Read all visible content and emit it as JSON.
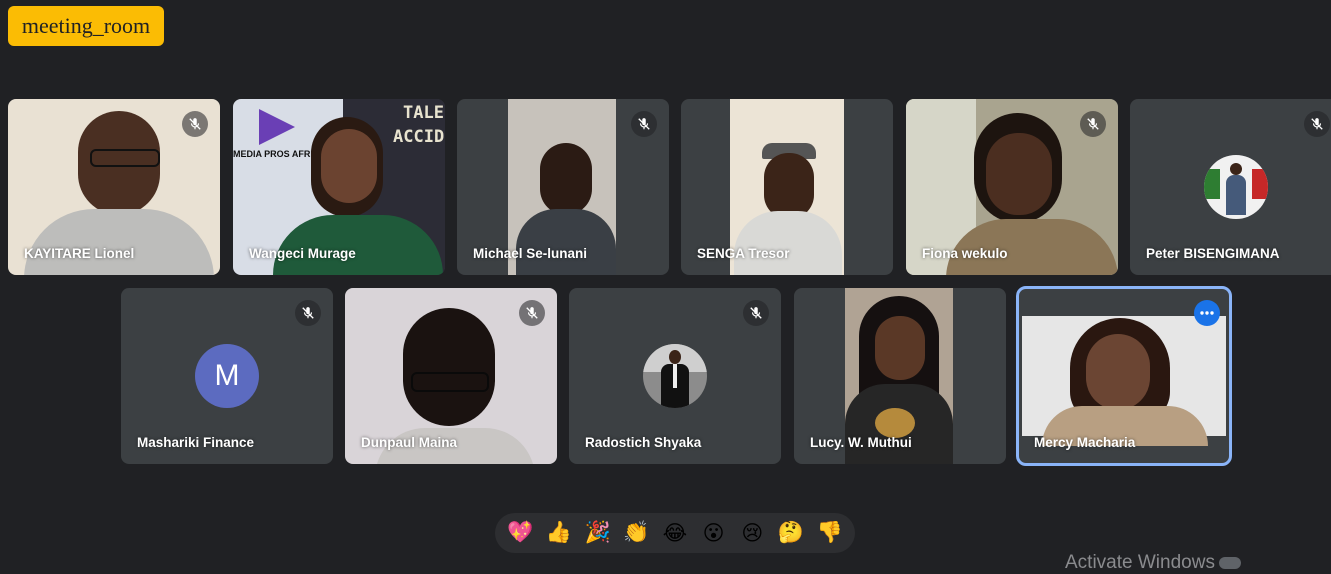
{
  "room": {
    "name": "meeting_room"
  },
  "participants": [
    {
      "name": "KAYITARE Lionel",
      "muted": true
    },
    {
      "name": "Wangeci Murage",
      "muted": false,
      "poster_text_1": "MEDIA PROS AFRIC",
      "poster_text_2": "TALE",
      "poster_text_3": "ACCID"
    },
    {
      "name": "Michael Se-lunani",
      "muted": true
    },
    {
      "name": "SENGA Tresor",
      "muted": false
    },
    {
      "name": "Fiona wekulo",
      "muted": true
    },
    {
      "name": "Peter BISENGIMANA",
      "muted": true
    },
    {
      "name": "Mashariki Finance",
      "muted": true,
      "avatar_letter": "M"
    },
    {
      "name": "Dunpaul Maina",
      "muted": true
    },
    {
      "name": "Radostich Shyaka",
      "muted": true
    },
    {
      "name": "Lucy. W. Muthui",
      "muted": false
    },
    {
      "name": "Mercy Macharia",
      "muted": false,
      "active": true
    }
  ],
  "reactions": [
    {
      "icon": "sparkling-heart-icon",
      "glyph": "💖"
    },
    {
      "icon": "thumbs-up-icon",
      "glyph": "👍"
    },
    {
      "icon": "party-popper-icon",
      "glyph": "🎉"
    },
    {
      "icon": "clapping-hands-icon",
      "glyph": "👏"
    },
    {
      "icon": "tears-of-joy-icon",
      "glyph": "😂"
    },
    {
      "icon": "surprised-face-icon",
      "glyph": "😮"
    },
    {
      "icon": "crying-face-icon",
      "glyph": "😢"
    },
    {
      "icon": "thinking-face-icon",
      "glyph": "🤔"
    },
    {
      "icon": "thumbs-down-icon",
      "glyph": "👎"
    }
  ],
  "watermark": {
    "text": "Activate Windows"
  },
  "colors": {
    "background": "#202124",
    "tile": "#3c4043",
    "badge": "#fbbc04",
    "accent": "#8ab4f8",
    "more_button": "#1a73e8"
  }
}
